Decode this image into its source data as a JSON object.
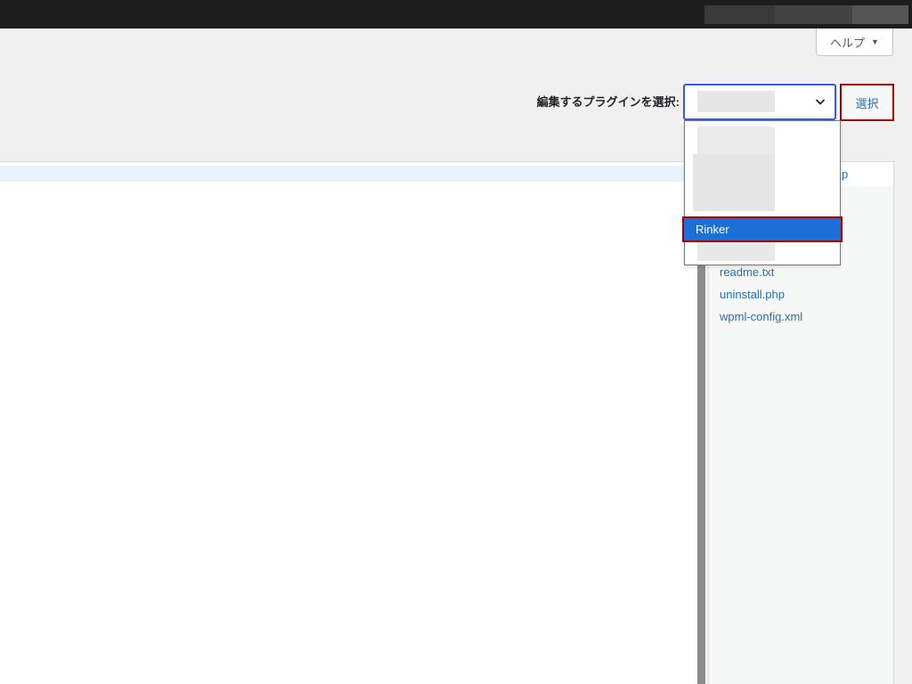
{
  "colors": {
    "page_bg": "#f0f0f0",
    "adminbar": "#1d1d1d",
    "accent": "#2271b1",
    "focus": "#3858e9",
    "option_highlight": "#1c6fd6",
    "annotation": "#a30000"
  },
  "admin_bar": {
    "redacted_blocks": [
      "#3a3a3a",
      "#434343",
      "#555555"
    ]
  },
  "help_tab": {
    "label": "ヘルプ",
    "arrow": "▼"
  },
  "plugin_select": {
    "label": "編集するプラグインを選択:",
    "selected_value": "",
    "icon": "chevron-down-icon",
    "submit_label": "選択",
    "options": [
      {
        "label": ""
      },
      {
        "label": ""
      },
      {
        "label": "Rinker",
        "highlighted": true
      },
      {
        "label": ""
      }
    ]
  },
  "file_list": {
    "current_file": "p",
    "files": [
      "readme.txt",
      "uninstall.php",
      "wpml-config.xml"
    ]
  }
}
